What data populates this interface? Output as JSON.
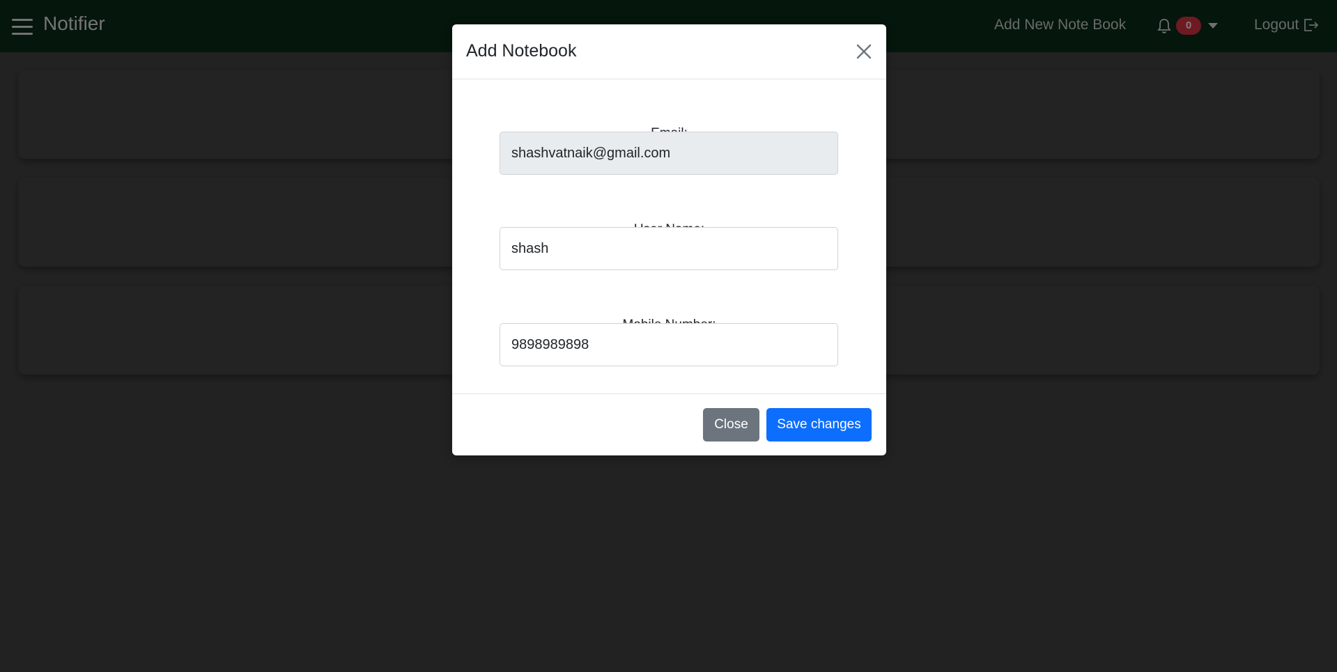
{
  "navbar": {
    "brand": "Notifier",
    "add_notebook_link": "Add New Note Book",
    "notification_count": "0",
    "logout_label": "Logout"
  },
  "modal": {
    "title": "Add Notebook",
    "fields": {
      "email": {
        "label": "Email:",
        "value": "shashvatnaik@gmail.com"
      },
      "username": {
        "label": "User Name:",
        "value": "shash"
      },
      "mobile": {
        "label": "Mobile Number:",
        "value": "9898989898"
      }
    },
    "close_label": "Close",
    "save_label": "Save changes"
  },
  "colors": {
    "navbar_bg": "#0a2c18",
    "badge": "#dc3545",
    "primary": "#0d6efd",
    "secondary": "#6c757d"
  }
}
